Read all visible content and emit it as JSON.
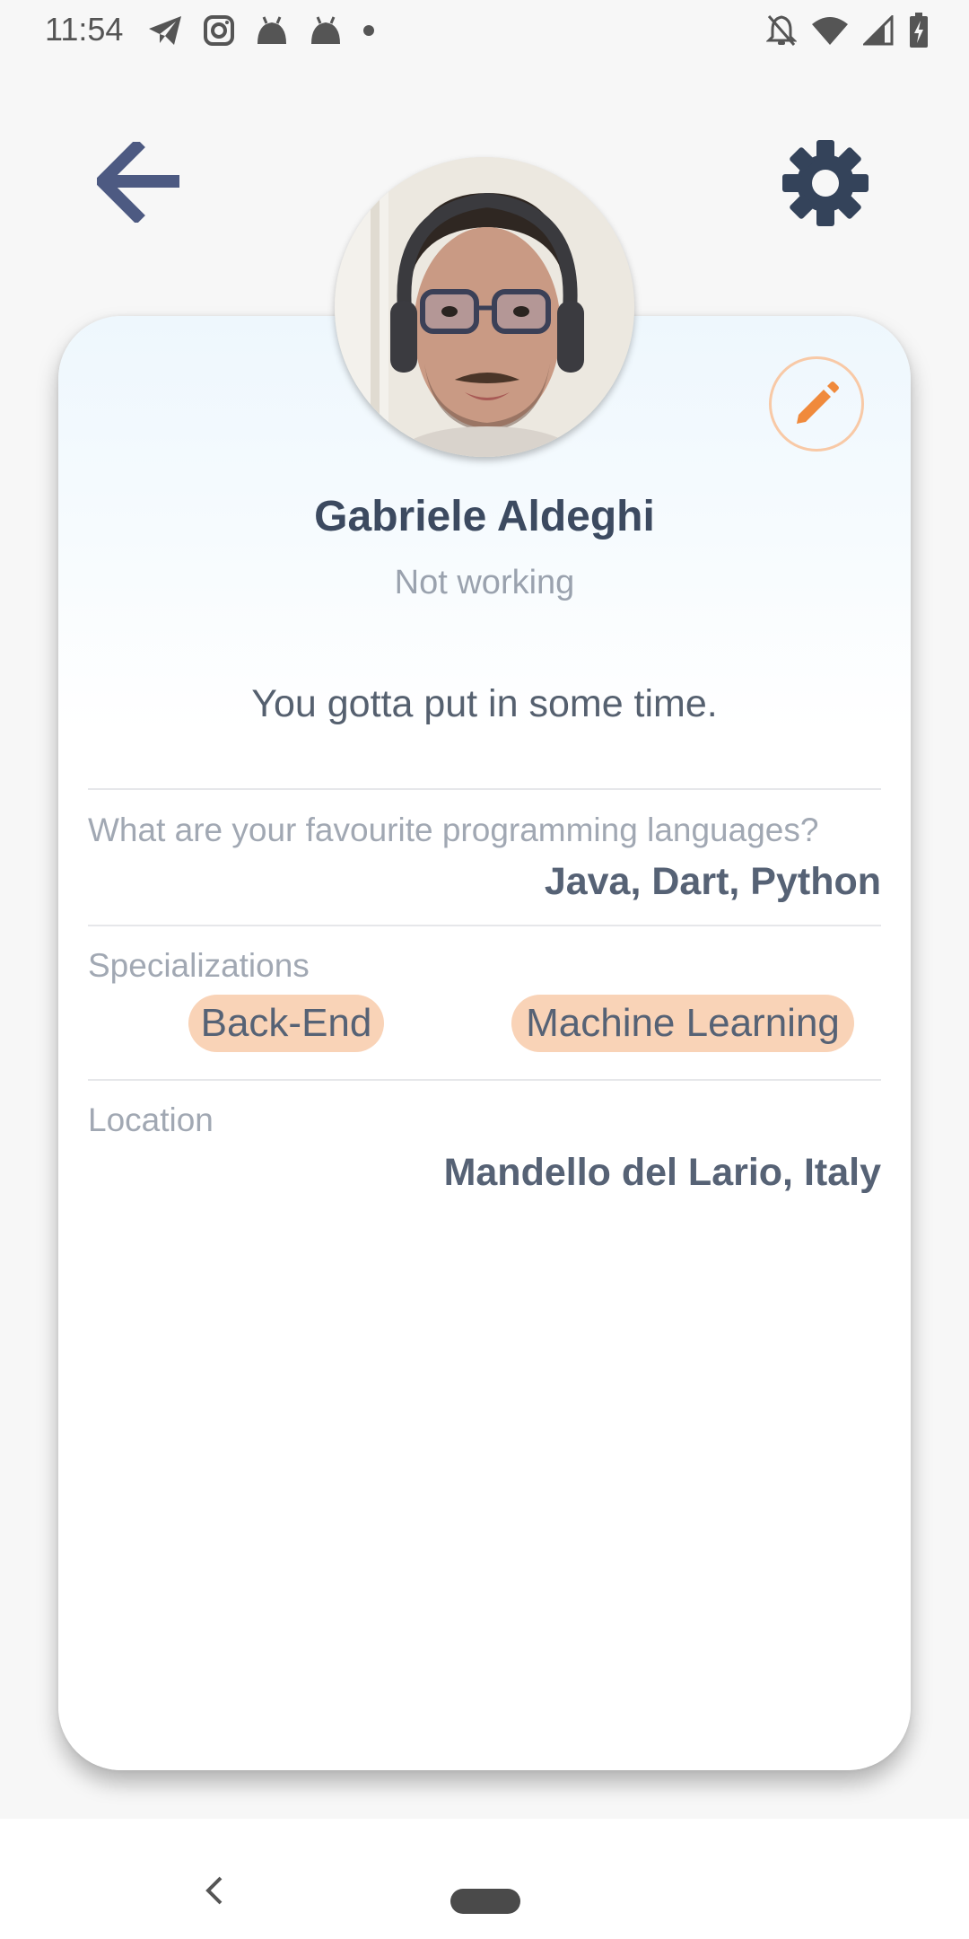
{
  "status_bar": {
    "time": "11:54",
    "left_icons": [
      "telegram-icon",
      "instagram-icon",
      "android-icon",
      "android-icon",
      "dot-icon"
    ],
    "right_icons": [
      "notifications-off-icon",
      "wifi-icon",
      "cellular-icon",
      "battery-charging-icon"
    ]
  },
  "header": {
    "back_icon": "arrow-left-icon",
    "settings_icon": "gear-icon"
  },
  "profile": {
    "name": "Gabriele Aldeghi",
    "job": "Not working",
    "bio": "You gotta put in some time.",
    "edit_icon": "pencil-icon"
  },
  "fields": {
    "languages": {
      "label": "What are your favourite programming languages?",
      "value": "Java, Dart, Python"
    },
    "specializations": {
      "label": "Specializations",
      "chips": [
        "Back-End",
        "Machine Learning"
      ]
    },
    "location": {
      "label": "Location",
      "value": "Mandello del Lario, Italy"
    }
  },
  "colors": {
    "accent_orange": "#f08a3c",
    "chip_bg": "#f9d3b7",
    "text_dark": "#3c4a60",
    "text_muted": "#9aa2ae",
    "icon_blue": "#4d5a82",
    "gear_dark": "#34435a"
  }
}
